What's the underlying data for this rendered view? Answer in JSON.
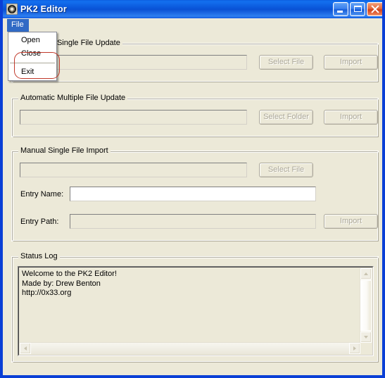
{
  "window": {
    "title": "PK2 Editor",
    "icon": "app-icon",
    "caption_buttons": {
      "minimize": "minimize-icon",
      "maximize": "maximize-icon",
      "close": "close-icon"
    },
    "accent_color": "#0a51d4",
    "face_color": "#ece9d8"
  },
  "menubar": {
    "items": [
      {
        "label": "File",
        "open": true
      }
    ]
  },
  "menu_file": {
    "items": [
      {
        "label": "Open",
        "highlighted": true
      },
      {
        "label": "Close",
        "highlighted": false
      },
      {
        "label": "Exit",
        "highlighted": false
      }
    ],
    "annotation_color": "#c0392b"
  },
  "groups": {
    "auto_single": {
      "title": "Automatic Single File Update",
      "visible_title": "Single File Update",
      "path_value": "",
      "path_placeholder": "",
      "select_button": "Select File",
      "import_button": "Import",
      "enabled": false
    },
    "auto_multiple": {
      "title": "Automatic Multiple File Update",
      "path_value": "",
      "path_placeholder": "",
      "select_button": "Select Folder",
      "import_button": "Import",
      "enabled": false
    },
    "manual_single": {
      "title": "Manual Single File Import",
      "path_value": "",
      "select_button": "Select File",
      "entry_name_label": "Entry Name:",
      "entry_name_value": "",
      "entry_path_label": "Entry Path:",
      "entry_path_value": "",
      "import_button": "Import",
      "enabled": false
    },
    "status_log": {
      "title": "Status Log",
      "content": "Welcome to the PK2 Editor!\nMade by: Drew Benton\nhttp://0x33.org",
      "scroll_vertical": true,
      "scroll_horizontal": true
    }
  }
}
